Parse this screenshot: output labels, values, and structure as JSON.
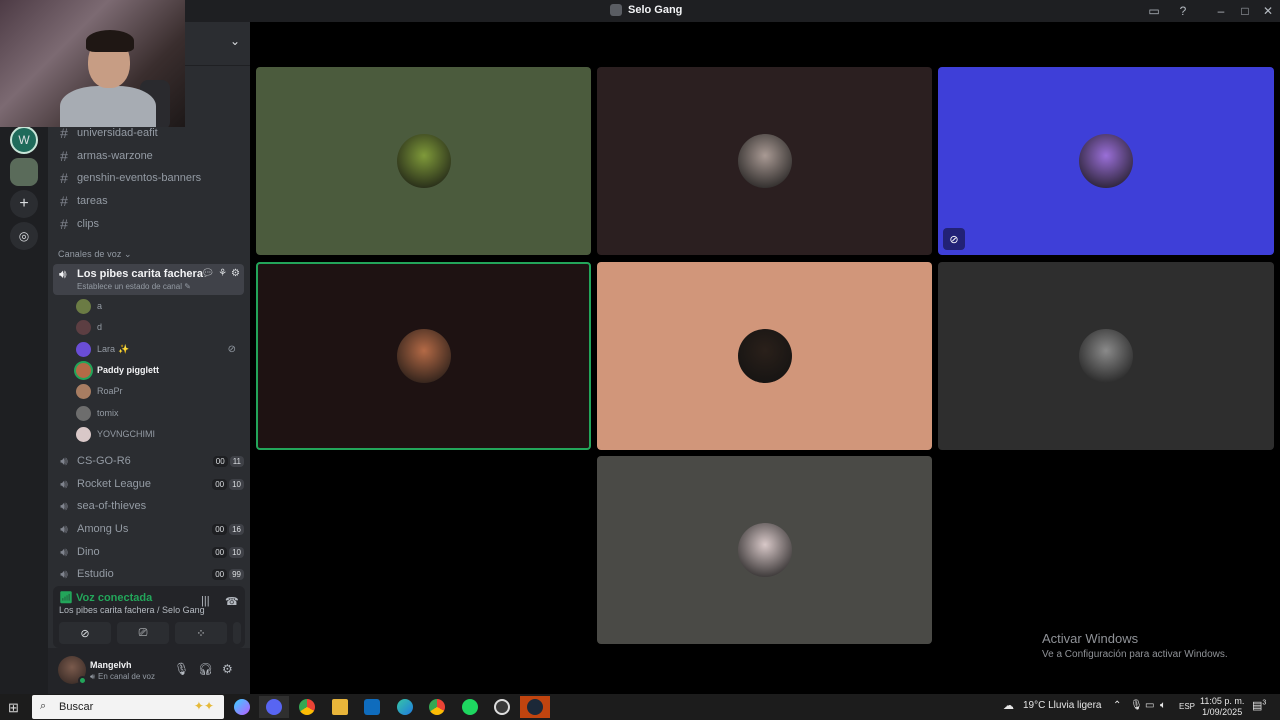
{
  "window": {
    "title": "Selo Gang"
  },
  "text_channels": [
    {
      "name": "universidad-eafit"
    },
    {
      "name": "armas-warzone"
    },
    {
      "name": "genshin-eventos-banners"
    },
    {
      "name": "tareas"
    },
    {
      "name": "clips"
    }
  ],
  "voice_category": "Canales de voz",
  "active_channel": {
    "name": "Los pibes carita fachera",
    "status_placeholder": "Establece un estado de canal"
  },
  "voice_users": [
    {
      "name": "a",
      "avatar_color": "#6b7b44"
    },
    {
      "name": "d",
      "avatar_color": "#5c3e42"
    },
    {
      "name": "Lara",
      "suffix": "✨",
      "avatar_color": "#6a4dd6"
    },
    {
      "name": "Paddy pigglett",
      "avatar_color": "#b46a46"
    },
    {
      "name": "RoaPr",
      "avatar_color": "#a87d62"
    },
    {
      "name": "tomix",
      "avatar_color": "#6d6d6d"
    },
    {
      "name": "YOVNGCHIMI",
      "avatar_color": "#d9c8c8"
    }
  ],
  "voice_channels": [
    {
      "name": "CS-GO-R6",
      "badge_a": "00",
      "badge_b": "11"
    },
    {
      "name": "Rocket League",
      "badge_a": "00",
      "badge_b": "10"
    },
    {
      "name": "sea-of-thieves",
      "badge_a": "",
      "badge_b": ""
    },
    {
      "name": "Among Us",
      "badge_a": "00",
      "badge_b": "16"
    },
    {
      "name": "Dino",
      "badge_a": "00",
      "badge_b": "10"
    },
    {
      "name": "Estudio",
      "badge_a": "00",
      "badge_b": "99"
    }
  ],
  "voice_panel": {
    "status": "Voz conectada",
    "channel": "Los pibes carita fachera / Selo Gang"
  },
  "user": {
    "name": "Mangelvh",
    "status": "En canal de voz"
  },
  "tiles": [
    {
      "bg": "#4b5b3d",
      "avatar": "#7f9a3a"
    },
    {
      "bg": "#2b1f20",
      "avatar": "#a99a94"
    },
    {
      "bg": "#3e3fd8",
      "avatar": "#9a6fd8",
      "muted": true
    },
    {
      "bg": "#1e1212",
      "avatar": "#b46a46",
      "speaking": true
    },
    {
      "bg": "#d1967a",
      "avatar": "#2a201a"
    },
    {
      "bg": "#2e2e2e",
      "avatar": "#8a8a8a"
    },
    {
      "bg": "#4a4a46",
      "avatar": "#d8c8c8"
    }
  ],
  "watermark": {
    "line1": "Activar Windows",
    "line2": "Ve a Configuración para activar Windows."
  },
  "taskbar": {
    "search_placeholder": "Buscar",
    "weather": "19°C  Lluvia ligera",
    "lang": "ESP",
    "time": "11:05 p. m.",
    "date": "1/09/2025",
    "notif_count": "3"
  },
  "colors": {
    "speaking": "#23a55a",
    "sidebar": "#2b2d31",
    "rail": "#1e1f22"
  }
}
